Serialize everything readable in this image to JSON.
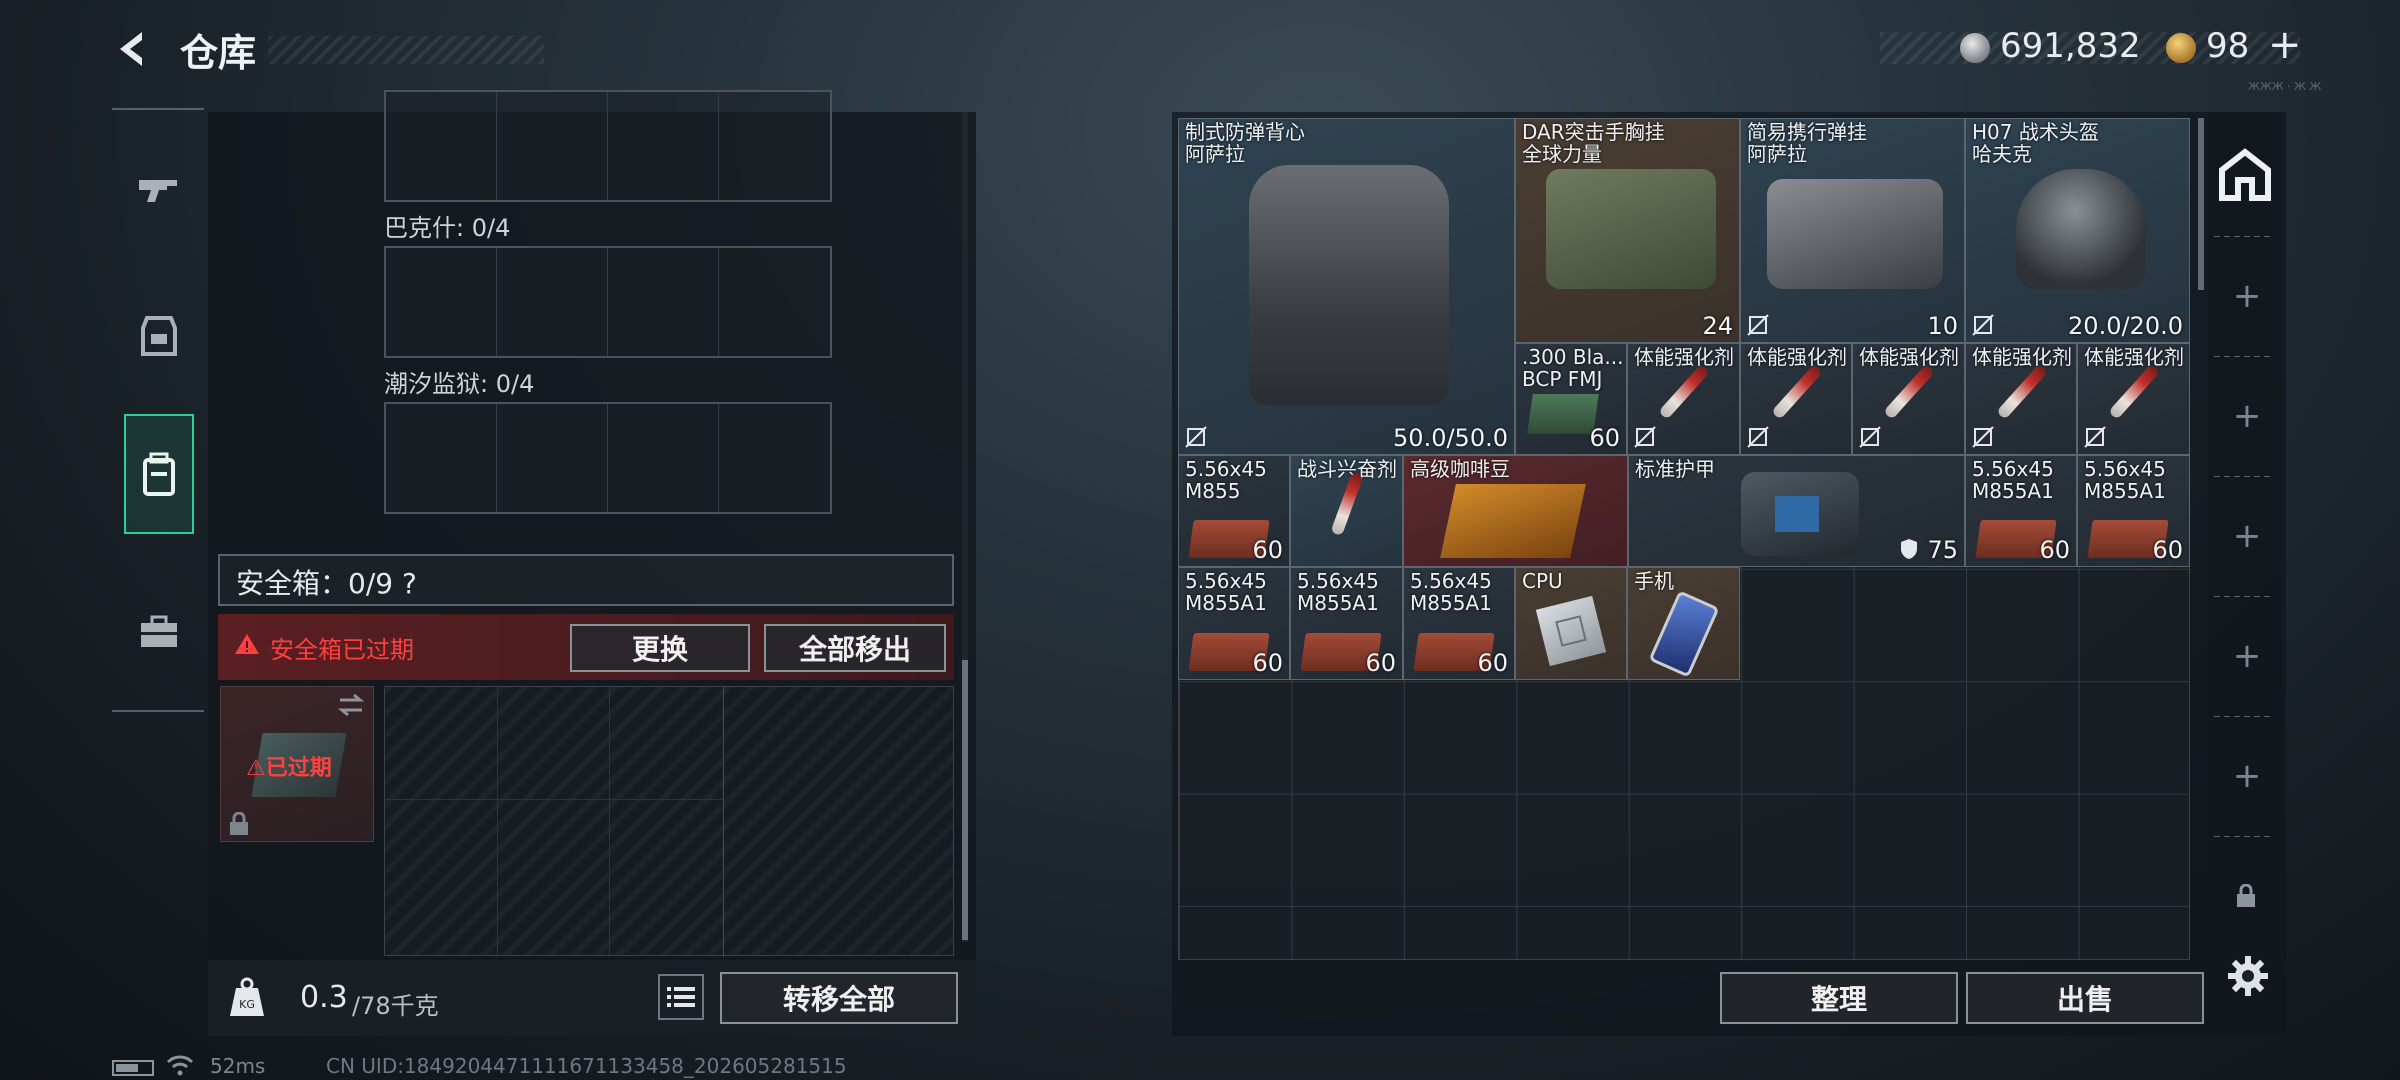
{
  "header": {
    "title": "仓库",
    "coins": "691,832",
    "gold": "98",
    "gold_plus": "+",
    "tiny": "ЖЖЖ · Ж Ж"
  },
  "left_panel": {
    "slots": [
      {
        "label": "巴克什: 0/4"
      },
      {
        "label": "潮汐监狱: 0/4"
      }
    ],
    "safe_box": {
      "label": "安全箱：0/9  ?",
      "expired_notice": "安全箱已过期",
      "replace_label": "更换",
      "move_all_label": "全部移出",
      "case_status": "已过期"
    },
    "weight": {
      "value": "0.3",
      "unit": "/78千克"
    },
    "transfer_all_label": "转移全部"
  },
  "inventory": {
    "items": [
      {
        "name": "制式防弹背心\n阿萨拉",
        "count": "50.0/50.0",
        "color": "#2f4352"
      },
      {
        "name": "DAR突击手胸挂\n全球力量",
        "count": "24",
        "color": "#4a3e33"
      },
      {
        "name": "简易携行弹挂\n阿萨拉",
        "count": "10",
        "color": "#2f4352"
      },
      {
        "name": "H07 战术头盔\n哈夫克",
        "count": "20.0/20.0",
        "color": "#2f4352"
      },
      {
        "name": ".300 Bla...\nBCP FMJ",
        "count": "60"
      },
      {
        "name": "体能强化剂",
        "count": ""
      },
      {
        "name": "体能强化剂",
        "count": ""
      },
      {
        "name": "体能强化剂",
        "count": ""
      },
      {
        "name": "体能强化剂",
        "count": ""
      },
      {
        "name": "体能强化剂",
        "count": ""
      },
      {
        "name": "5.56x45\nM855",
        "count": "60"
      },
      {
        "name": "战斗兴奋剂",
        "count": ""
      },
      {
        "name": "高级咖啡豆",
        "count": ""
      },
      {
        "name": "标准护甲",
        "count": "75"
      },
      {
        "name": "5.56x45\nM855A1",
        "count": "60"
      },
      {
        "name": "5.56x45\nM855A1",
        "count": "60"
      },
      {
        "name": "5.56x45\nM855A1",
        "count": "60"
      },
      {
        "name": "5.56x45\nM855A1",
        "count": "60"
      },
      {
        "name": "5.56x45\nM855A1",
        "count": "60"
      },
      {
        "name": "CPU",
        "count": ""
      },
      {
        "name": "手机",
        "count": ""
      }
    ],
    "sort_label": "整理",
    "sell_label": "出售"
  },
  "footer": {
    "ping": "52ms",
    "uid": "CN UID:18492044711116711334​58_202605281515"
  },
  "colors": {
    "accent": "#2fcf94",
    "danger": "#ff3f3f",
    "rare_blue": "#2f4352",
    "rare_brown": "#4a3e33",
    "rare_red": "#5a2a2e"
  }
}
